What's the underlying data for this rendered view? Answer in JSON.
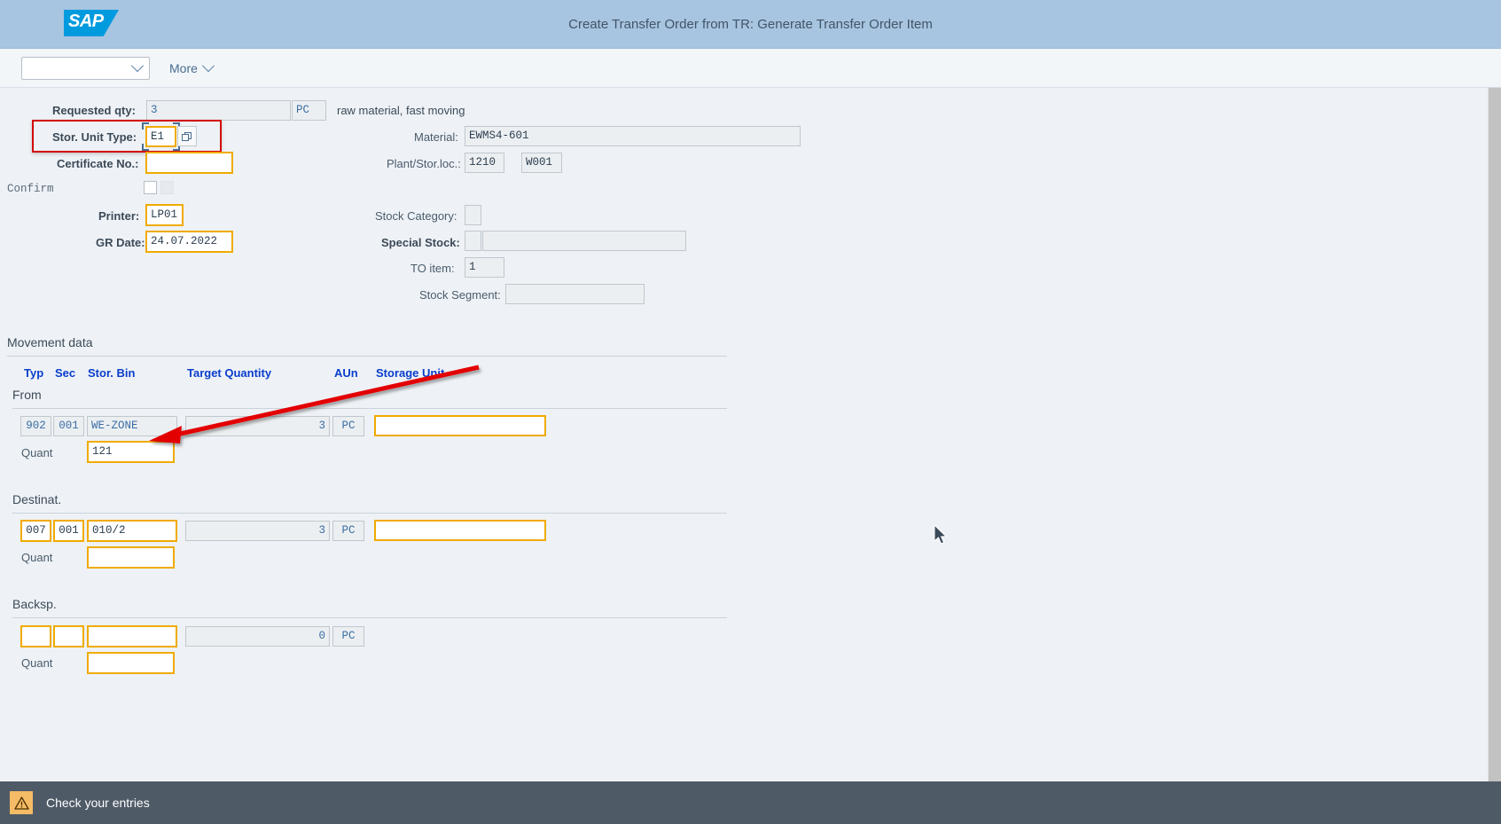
{
  "shell": {
    "logo_text": "SAP",
    "title": "Create Transfer Order from TR: Generate Transfer Order Item"
  },
  "toolbar": {
    "select_value": "",
    "more_label": "More"
  },
  "form": {
    "requested_qty": {
      "label": "Requested qty:",
      "value": "3",
      "uom": "PC",
      "description": "raw material, fast moving"
    },
    "stor_unit_type": {
      "label": "Stor. Unit Type:",
      "value": "E1"
    },
    "certificate_no": {
      "label": "Certificate No.:",
      "value": ""
    },
    "confirm": {
      "label": "Confirm",
      "checkbox1": false,
      "checkbox2": false
    },
    "printer": {
      "label": "Printer:",
      "value": "LP01"
    },
    "gr_date": {
      "label": "GR Date:",
      "value": "24.07.2022"
    },
    "material": {
      "label": "Material:",
      "value": "EWMS4-601"
    },
    "plant_storloc": {
      "label": "Plant/Stor.loc.:",
      "plant": "1210",
      "storloc": "W001"
    },
    "stock_category": {
      "label": "Stock Category:",
      "value": ""
    },
    "special_stock": {
      "label": "Special Stock:",
      "value": "",
      "text": ""
    },
    "to_item": {
      "label": "TO item:",
      "value": "1"
    },
    "stock_segment": {
      "label": "Stock Segment:",
      "value": ""
    }
  },
  "movement": {
    "section_label": "Movement data",
    "columns": {
      "typ": "Typ",
      "sec": "Sec",
      "stor_bin": "Stor. Bin",
      "target_qty": "Target Quantity",
      "aun": "AUn",
      "storage_unit": "Storage Unit"
    },
    "quant_label": "Quant",
    "groups": [
      {
        "name": "from",
        "title": "From",
        "typ": "902",
        "sec": "001",
        "stor_bin": "WE-ZONE",
        "target_qty": "3",
        "aun": "PC",
        "storage_unit": "",
        "quant": "121"
      },
      {
        "name": "destination",
        "title": "Destinat.",
        "typ": "007",
        "sec": "001",
        "stor_bin": "010/2",
        "target_qty": "3",
        "aun": "PC",
        "storage_unit": "",
        "quant": ""
      },
      {
        "name": "backspace",
        "title": "Backsp.",
        "typ": "",
        "sec": "",
        "stor_bin": "",
        "target_qty": "0",
        "aun": "PC",
        "storage_unit": "",
        "quant": ""
      }
    ]
  },
  "footer": {
    "message": "Check your entries",
    "icon": "warning-icon"
  },
  "colors": {
    "header_bg": "#a7c4e0",
    "sap_blue": "#009ade",
    "accent_orange": "#f0ab00",
    "annotation_red": "#d40000",
    "footer_bg": "#4e5a66",
    "link_blue": "#0a3dcc"
  }
}
